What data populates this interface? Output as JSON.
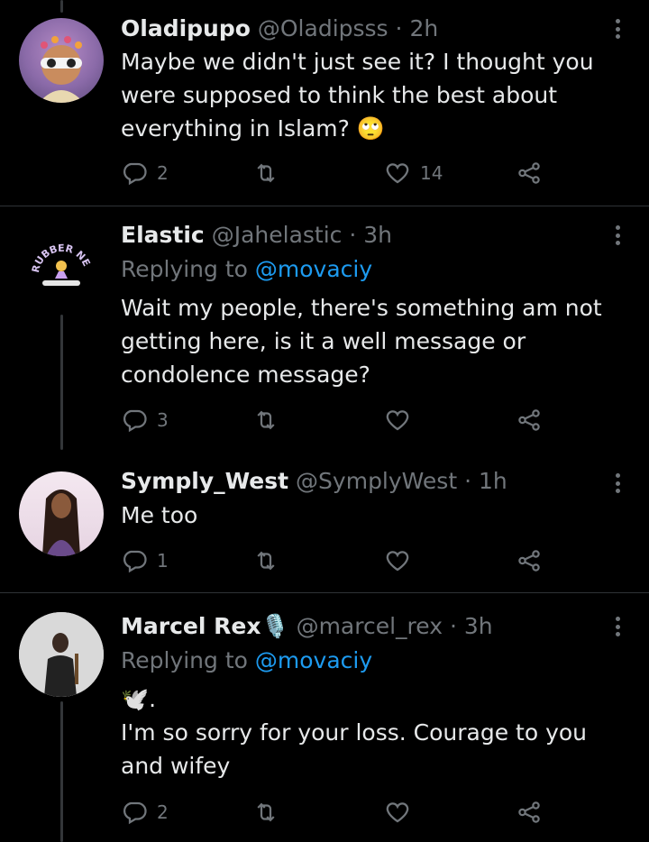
{
  "colors": {
    "background": "#000000",
    "text": "#e7e9ea",
    "secondary": "#71767b",
    "link": "#1d9bf0",
    "divider": "#2f3336"
  },
  "tweets": [
    {
      "name": "Oladipupo",
      "handle": "@Oladipsss",
      "dot": "·",
      "time": "2h",
      "replying_prefix": "",
      "replying_to": "",
      "text": "Maybe we didn't just see it? I thought you were supposed to think the best about everything in Islam? 🙄",
      "reply_count": "2",
      "retweet_count": "",
      "like_count": "14"
    },
    {
      "name": "Elastic",
      "handle": "@Jahelastic",
      "dot": "·",
      "time": "3h",
      "replying_prefix": "Replying to ",
      "replying_to": "@movaciy",
      "text": "Wait my people, there's something am not getting here, is it a well message or condolence message?",
      "reply_count": "3",
      "retweet_count": "",
      "like_count": "",
      "avatar_logo_text": "RUBBER NECK"
    },
    {
      "name": "Symply_West",
      "handle": "@SymplyWest",
      "dot": "·",
      "time": "1h",
      "replying_prefix": "",
      "replying_to": "",
      "text": "Me too",
      "reply_count": "1",
      "retweet_count": "",
      "like_count": ""
    },
    {
      "name": "Marcel Rex",
      "name_emoji": "🎙️",
      "handle": "@marcel_rex",
      "dot": "·",
      "time": "3h",
      "replying_prefix": "Replying to ",
      "replying_to": "@movaciy",
      "line1": "🕊️.",
      "text": "I'm so sorry for your loss. Courage to you and wifey",
      "reply_count": "2",
      "retweet_count": "",
      "like_count": ""
    }
  ],
  "icons": {
    "reply": "reply-icon",
    "retweet": "retweet-icon",
    "like": "heart-icon",
    "share": "share-icon",
    "more": "more-icon"
  }
}
